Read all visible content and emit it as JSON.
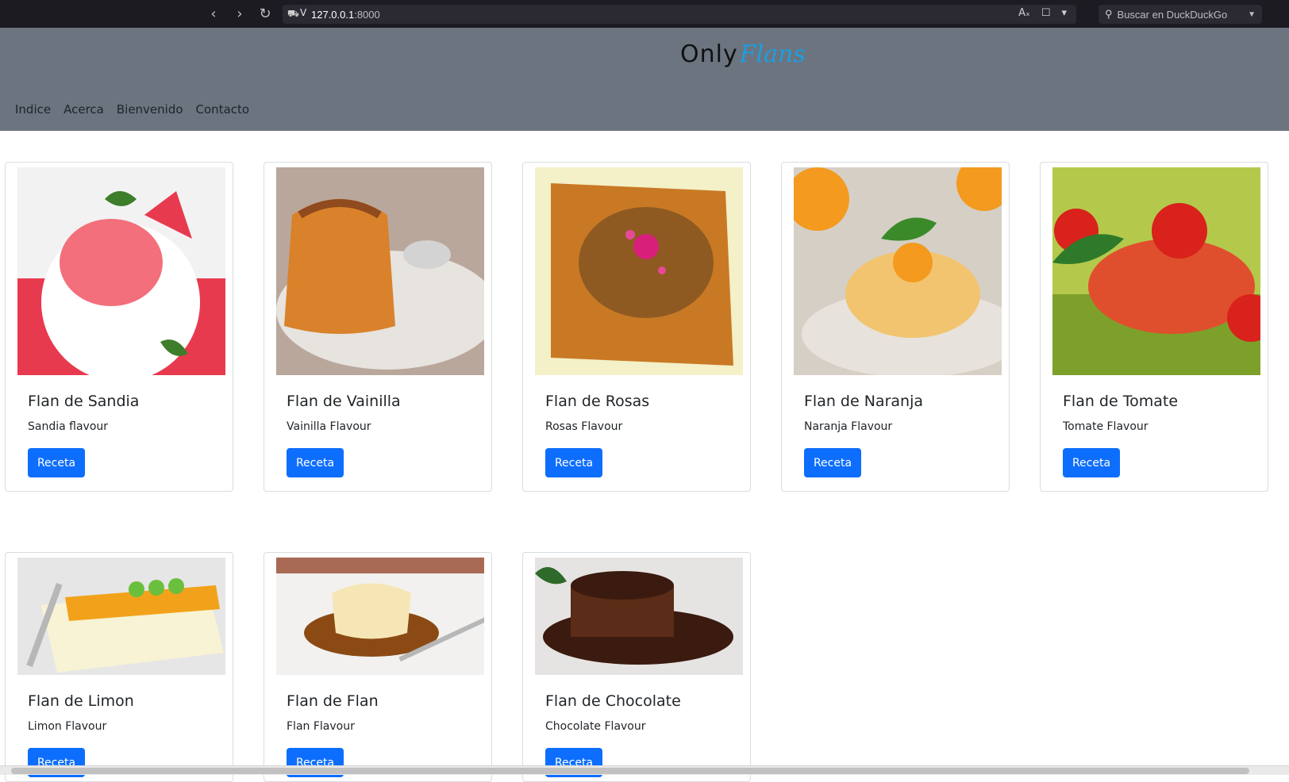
{
  "browser": {
    "url_host": "127.0.0.1",
    "url_port": ":8000",
    "search_placeholder": "Buscar en DuckDuckGo"
  },
  "site": {
    "logo_only": "Only",
    "logo_flans": "Flans",
    "nav": [
      "Indice",
      "Acerca",
      "Bienvenido",
      "Contacto"
    ]
  },
  "cards": [
    {
      "title": "Flan de Sandia",
      "desc": "Sandia flavour",
      "button": "Receta",
      "image_colors": [
        "#e83a4f",
        "#f2f2f2",
        "#f36f7b",
        "#3e7d2a"
      ]
    },
    {
      "title": "Flan de Vainilla",
      "desc": "Vainilla Flavour",
      "button": "Receta",
      "image_colors": [
        "#b86a2b",
        "#e7e3df",
        "#d9822b",
        "#8f4a1d"
      ]
    },
    {
      "title": "Flan de Rosas",
      "desc": "Rosas Flavour",
      "button": "Receta",
      "image_colors": [
        "#8f5a22",
        "#f4f0c8",
        "#c97924",
        "#d81f7a"
      ]
    },
    {
      "title": "Flan de Naranja",
      "desc": "Naranja Flavour",
      "button": "Receta",
      "image_colors": [
        "#f39a1f",
        "#e7e2dc",
        "#f2c46f",
        "#3a8a2a"
      ]
    },
    {
      "title": "Flan de Tomate",
      "desc": "Tomate Flavour",
      "button": "Receta",
      "image_colors": [
        "#7da02a",
        "#b4c94b",
        "#e04f2d",
        "#d8221b"
      ]
    },
    {
      "title": "Flan de Limon",
      "desc": "Limon Flavour",
      "button": "Receta",
      "image_colors": [
        "#f1edd0",
        "#f7f3d4",
        "#f2a21a",
        "#6abf3c"
      ]
    },
    {
      "title": "Flan de Flan",
      "desc": "Flan Flavour",
      "button": "Receta",
      "image_colors": [
        "#a86a55",
        "#f2f1ef",
        "#f7e6b5",
        "#8b4a14"
      ]
    },
    {
      "title": "Flan de Chocolate",
      "desc": "Chocolate Flavour",
      "button": "Receta",
      "image_colors": [
        "#e6e4e3",
        "#3b1b0f",
        "#5b2c17",
        "#2f6a2a"
      ]
    }
  ]
}
